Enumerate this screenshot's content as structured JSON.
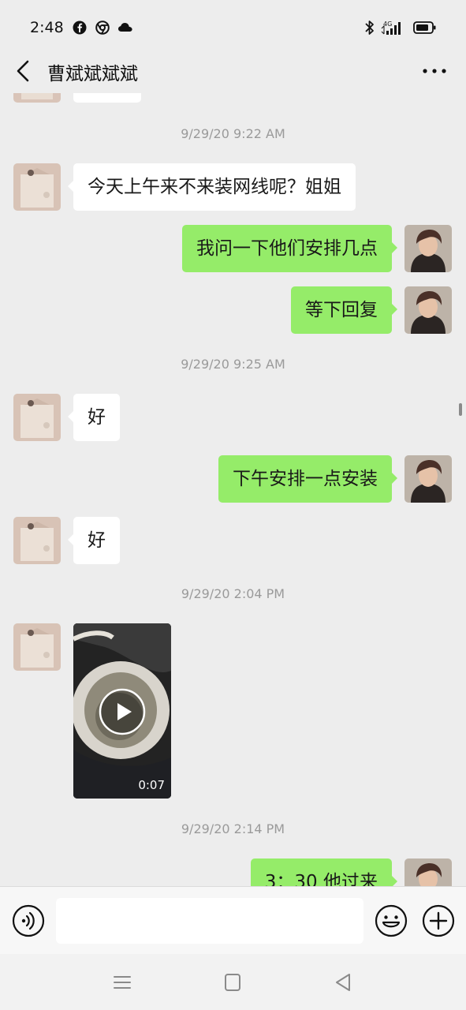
{
  "status_bar": {
    "time": "2:48",
    "left_icons": [
      "facebook-icon",
      "chrome-icon",
      "cloud-icon"
    ],
    "right_icons": [
      "bluetooth-icon",
      "4g-signal-icon",
      "battery-icon"
    ],
    "network": "4G"
  },
  "header": {
    "title": "曹斌斌斌斌",
    "back_icon": "chevron-left-icon",
    "more_icon": "more-icon"
  },
  "chat": {
    "timestamps": [
      "9/29/20 9:22 AM",
      "9/29/20 9:25 AM",
      "9/29/20 2:04 PM",
      "9/29/20 2:14 PM"
    ],
    "messages": [
      {
        "side": "left",
        "text": "今天上午来不来装网线呢？姐姐"
      },
      {
        "side": "right",
        "text": "我问一下他们安排几点"
      },
      {
        "side": "right",
        "text": "等下回复"
      },
      {
        "side": "left",
        "text": "好"
      },
      {
        "side": "right",
        "text": "下午安排一点安装"
      },
      {
        "side": "left",
        "text": "好"
      },
      {
        "side": "left",
        "type": "video",
        "duration": "0:07"
      },
      {
        "side": "right",
        "text": "3：30 他过来"
      }
    ],
    "bubble_color_sent": "#95ec69",
    "bubble_color_received": "#ffffff"
  },
  "input_bar": {
    "voice_icon": "voice-icon",
    "emoji_icon": "emoji-icon",
    "plus_icon": "plus-icon",
    "text": ""
  },
  "nav_bar": {
    "icons": [
      "menu-icon",
      "home-icon",
      "back-icon"
    ]
  }
}
